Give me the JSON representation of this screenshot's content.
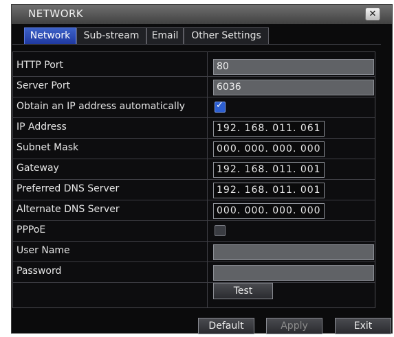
{
  "window": {
    "title": "NETWORK",
    "close_label": "✕"
  },
  "tabs": [
    {
      "label": "Network",
      "active": true
    },
    {
      "label": "Sub-stream",
      "active": false
    },
    {
      "label": "Email",
      "active": false
    },
    {
      "label": "Other Settings",
      "active": false
    }
  ],
  "settings": {
    "http_port": {
      "label": "HTTP Port",
      "value": "80"
    },
    "server_port": {
      "label": "Server Port",
      "value": "6036"
    },
    "dhcp": {
      "label": "Obtain an IP address automatically",
      "checked": true
    },
    "ip_address": {
      "label": "IP Address",
      "value": "192. 168. 011. 061"
    },
    "subnet_mask": {
      "label": "Subnet Mask",
      "value": "000. 000. 000. 000"
    },
    "gateway": {
      "label": "Gateway",
      "value": "192. 168. 011. 001"
    },
    "preferred_dns": {
      "label": "Preferred DNS Server",
      "value": "192. 168. 011. 001"
    },
    "alternate_dns": {
      "label": "Alternate DNS Server",
      "value": "000. 000. 000. 000"
    },
    "pppoe": {
      "label": "PPPoE",
      "checked": false
    },
    "user_name": {
      "label": "User Name",
      "value": ""
    },
    "password": {
      "label": "Password",
      "value": ""
    },
    "test_label": "Test"
  },
  "footer": {
    "default_label": "Default",
    "apply_label": "Apply",
    "exit_label": "Exit"
  },
  "colors": {
    "accent": "#2d5fd1",
    "tab_active": "#3e62c8",
    "background": "#0b0b0c"
  }
}
